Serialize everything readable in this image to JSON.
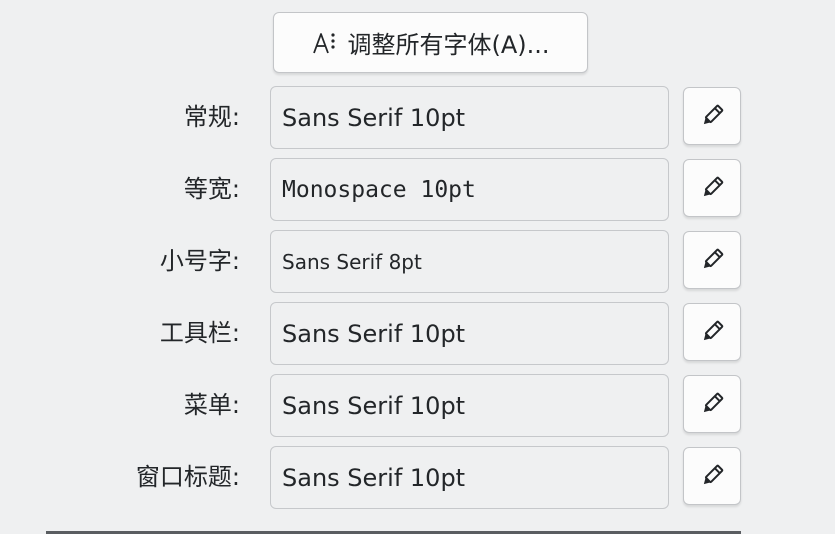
{
  "adjust_all": {
    "label": "调整所有字体(A)...",
    "icon": "font-adjust-icon"
  },
  "fonts": [
    {
      "key": "general",
      "label": "常规:",
      "value": "Sans Serif 10pt"
    },
    {
      "key": "fixed",
      "label": "等宽:",
      "value": "Monospace 10pt"
    },
    {
      "key": "small",
      "label": "小号字:",
      "value": "Sans Serif 8pt"
    },
    {
      "key": "toolbar",
      "label": "工具栏:",
      "value": "Sans Serif 10pt"
    },
    {
      "key": "menu",
      "label": "菜单:",
      "value": "Sans Serif 10pt"
    },
    {
      "key": "window_title",
      "label": "窗口标题:",
      "value": "Sans Serif 10pt"
    }
  ],
  "edit_icon": "pencil-icon",
  "colors": {
    "background": "#eff0f1",
    "button": "#fcfcfc",
    "border": "#c3c5c8",
    "text": "#232629"
  }
}
